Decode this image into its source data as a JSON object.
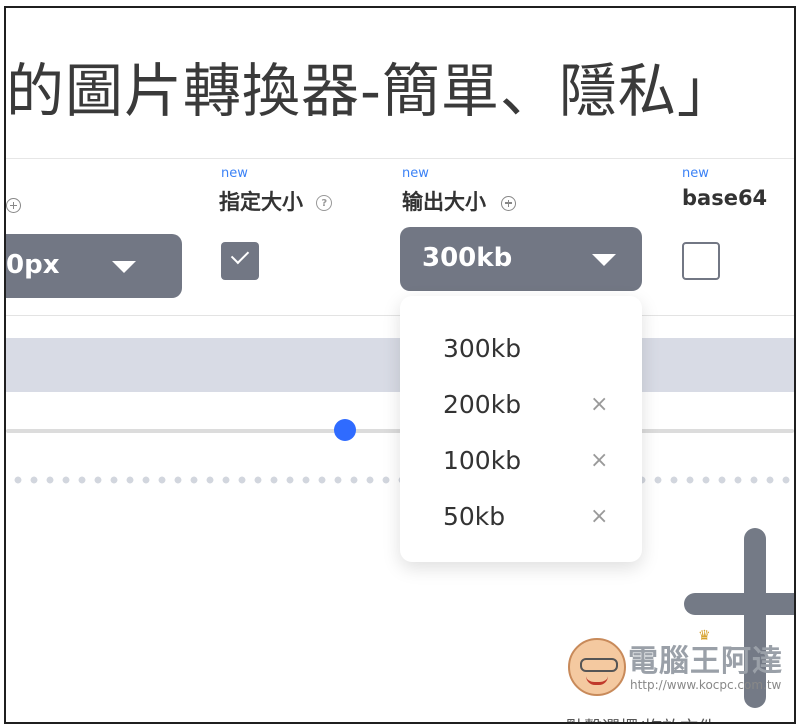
{
  "title": "的圖片轉換器-簡單、隱私」",
  "options": {
    "width_partial": {
      "value": "0px"
    },
    "specify_size": {
      "new": "new",
      "label": "指定大小",
      "help_icon": "help-icon",
      "checked": true
    },
    "output_size": {
      "new": "new",
      "label": "输出大小",
      "add_icon": "plus-circle-icon",
      "value": "300kb"
    },
    "base64": {
      "new": "new",
      "label": "base64",
      "checked": false
    }
  },
  "dropdown": {
    "items": [
      {
        "label": "300kb",
        "removable": false
      },
      {
        "label": "200kb",
        "removable": true
      },
      {
        "label": "100kb",
        "removable": true
      },
      {
        "label": "50kb",
        "removable": true
      }
    ],
    "remove_glyph": "×"
  },
  "watermark": {
    "text": "電腦王阿達",
    "url": "http://www.kocpc.com.tw"
  },
  "bottom_text": "點擊選擇/拖放文件"
}
